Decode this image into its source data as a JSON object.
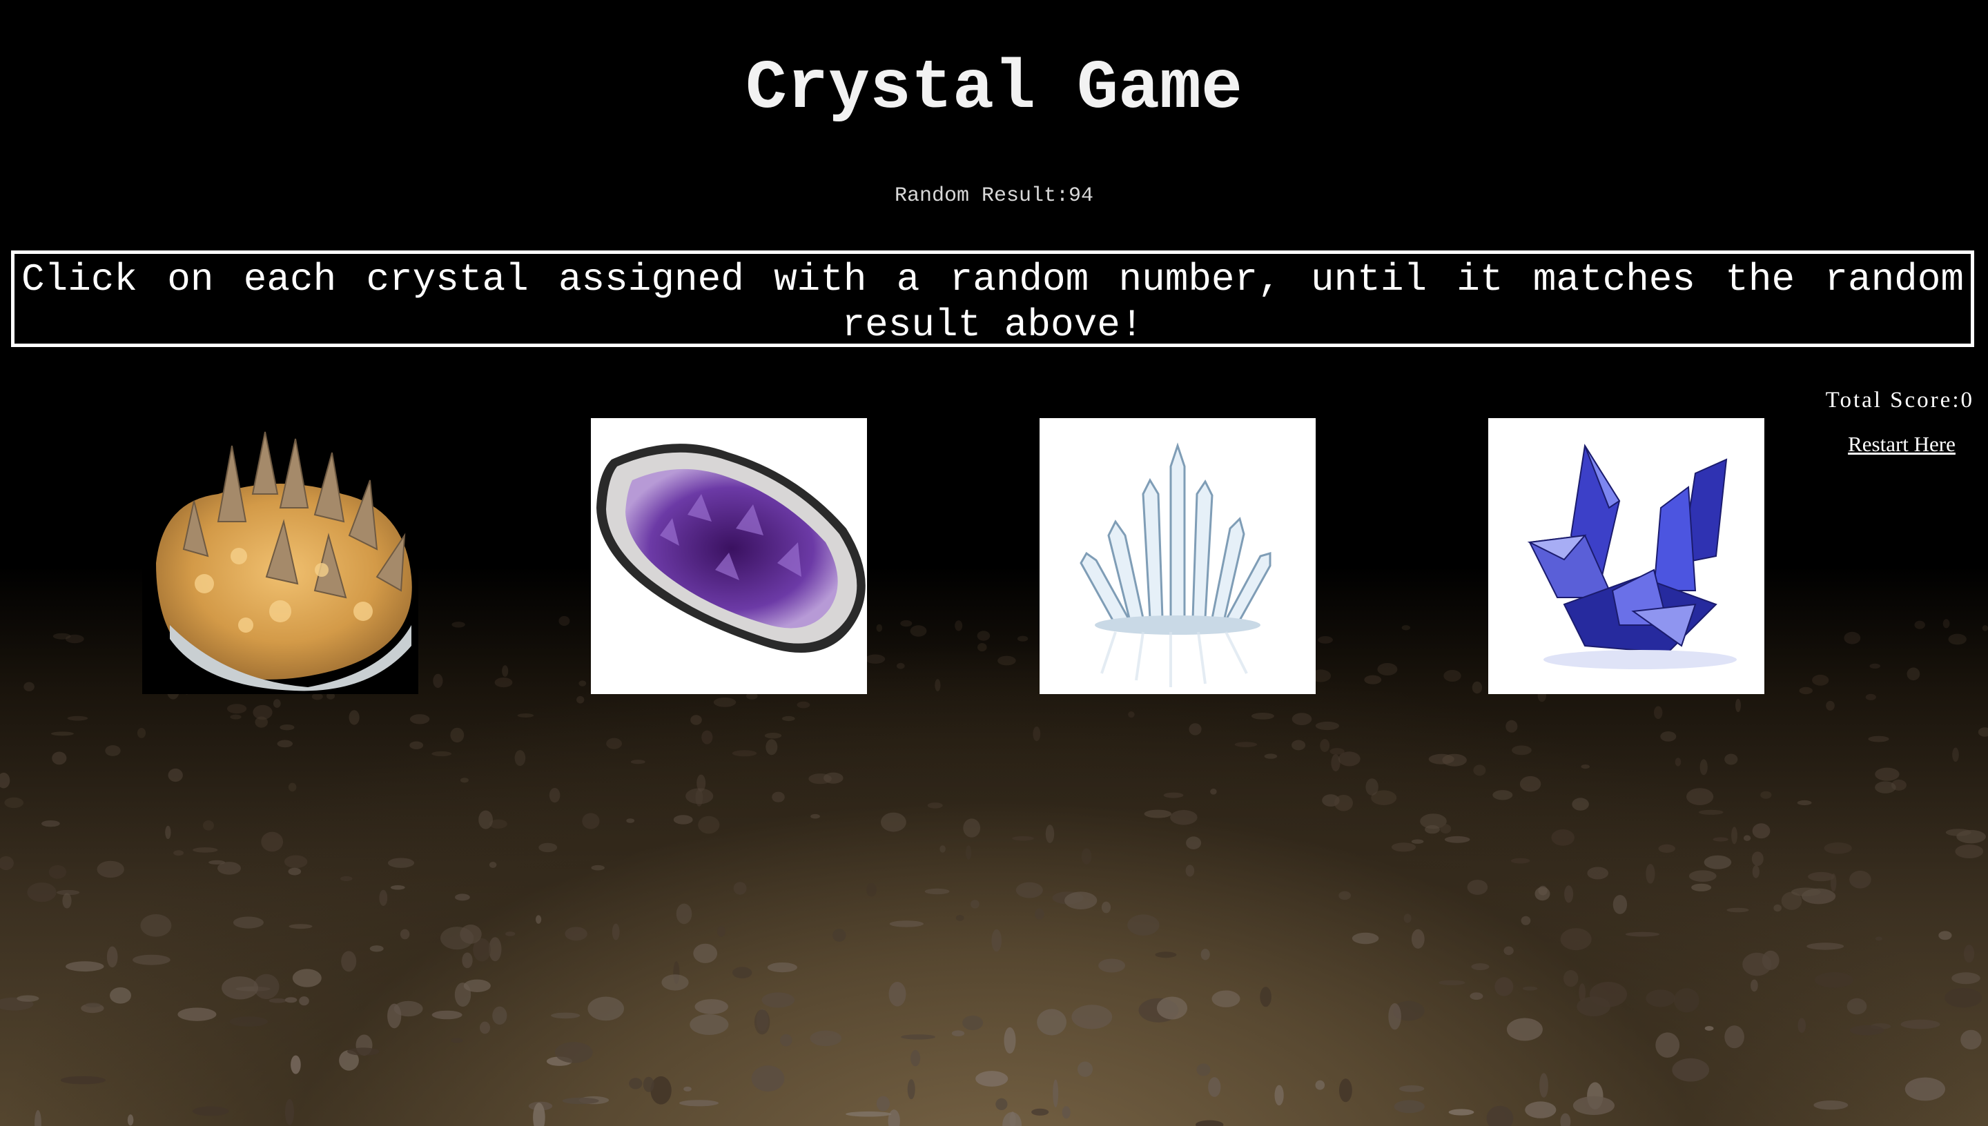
{
  "title": "Crystal Game",
  "random_result_label": "Random Result:",
  "random_result_value": "94",
  "instructions": "Click on each crystal assigned with a random number, until it matches the random result above!",
  "total_score_label": "Total Score:",
  "total_score_value": "0",
  "restart_label": "Restart Here",
  "crystals": [
    {
      "name": "citrine-quartz-cluster",
      "color": "#d9a24a"
    },
    {
      "name": "amethyst-geode",
      "color": "#5b2b8f"
    },
    {
      "name": "clear-quartz-cluster",
      "color": "#a9c4d8"
    },
    {
      "name": "blue-sapphire-cluster",
      "color": "#3b3fc7"
    }
  ]
}
